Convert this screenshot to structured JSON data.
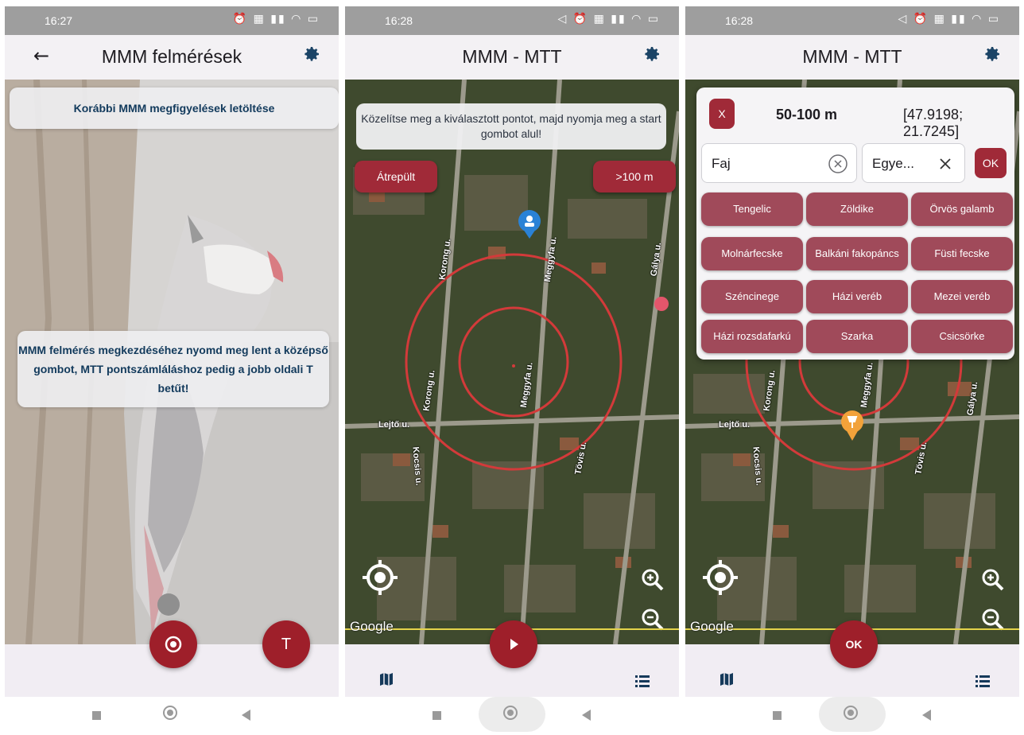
{
  "screen1": {
    "status_time": "16:27",
    "title": "MMM felmérések",
    "download_card": "Korábbi MMM megfigyelések letöltése",
    "hint_card": "MMM felmérés megkezdéséhez nyomd meg lent a középső gombot, MTT pontszámláláshoz pedig a jobb oldali T betűt!",
    "fab_t_label": "T"
  },
  "screen2": {
    "status_time": "16:28",
    "title": "MMM - MTT",
    "hint": "Közelítse meg a kiválasztott pontot, majd nyomja meg a start gombot alul!",
    "atrepult_button": "Átrepült",
    "distance_button": ">100 m",
    "google_label": "Google",
    "roads": [
      "Korong u.",
      "Meggyfa u.",
      "Gálya u.",
      "Lejtő u.",
      "Kocsis u.",
      "Tövis u.",
      "Korong u.",
      "Meggyfa u."
    ]
  },
  "screen3": {
    "status_time": "16:28",
    "title": "MMM - MTT",
    "close_label": "X",
    "distance": "50-100 m",
    "coords": "[47.9198; 21.7245]",
    "species_field": "Faj",
    "count_field": "Egye...",
    "ok_small": "OK",
    "species": [
      "Tengelic",
      "Zöldike",
      "Örvös galamb",
      "Molnárfecske",
      "Balkáni fakopáncs",
      "Füsti fecske",
      "Széncinege",
      "Házi veréb",
      "Mezei veréb",
      "Házi rozsdafarkú",
      "Szarka",
      "Csicsörke"
    ],
    "google_label": "Google",
    "roads": [
      "Korong u.",
      "Meggyfa u.",
      "Gálya u.",
      "Lejtő u.",
      "Kocsis u.",
      "Tövis u."
    ],
    "fab_ok": "OK"
  },
  "icons": {
    "status_right": "alarm-sim-signal-wifi-battery",
    "gear": "gear-icon",
    "back": "arrow-left-icon",
    "location": "crosshair-icon",
    "zoom_in": "zoom-in-icon",
    "zoom_out": "zoom-out-icon",
    "map_tab": "map-icon",
    "list_tab": "list-icon"
  },
  "colors": {
    "accent": "#9e1f2a",
    "chip": "#a04a5a",
    "title_text": "#123a5c"
  }
}
